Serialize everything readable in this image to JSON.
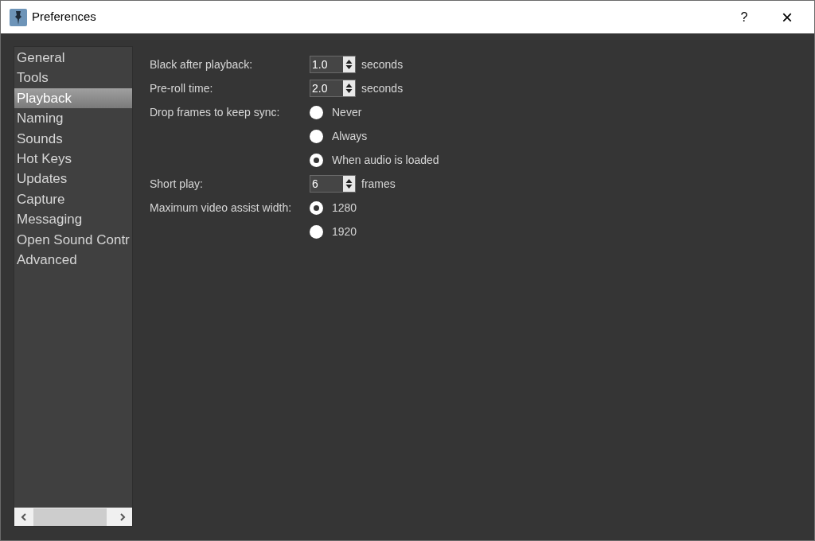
{
  "window": {
    "title": "Preferences",
    "help": "?",
    "close": "×"
  },
  "sidebar": {
    "items": [
      {
        "label": "General",
        "selected": false
      },
      {
        "label": "Tools",
        "selected": false
      },
      {
        "label": "Playback",
        "selected": true
      },
      {
        "label": "Naming",
        "selected": false
      },
      {
        "label": "Sounds",
        "selected": false
      },
      {
        "label": "Hot Keys",
        "selected": false
      },
      {
        "label": "Updates",
        "selected": false
      },
      {
        "label": "Capture",
        "selected": false
      },
      {
        "label": "Messaging",
        "selected": false
      },
      {
        "label": "Open Sound Contr",
        "selected": false
      },
      {
        "label": "Advanced",
        "selected": false
      }
    ]
  },
  "form": {
    "rows": [
      {
        "kind": "spin",
        "label": "Black after playback:",
        "value": "1.0",
        "unit": "seconds"
      },
      {
        "kind": "spin",
        "label": "Pre-roll time:",
        "value": "2.0",
        "unit": "seconds"
      },
      {
        "kind": "radio",
        "label": "Drop frames to keep sync:",
        "options": [
          {
            "label": "Never",
            "selected": false
          },
          {
            "label": "Always",
            "selected": false
          },
          {
            "label": "When audio is loaded",
            "selected": true
          }
        ]
      },
      {
        "kind": "spin",
        "label": "Short play:",
        "value": "6",
        "unit": "frames"
      },
      {
        "kind": "radio",
        "label": "Maximum video assist width:",
        "options": [
          {
            "label": "1280",
            "selected": true
          },
          {
            "label": "1920",
            "selected": false
          }
        ]
      }
    ]
  }
}
